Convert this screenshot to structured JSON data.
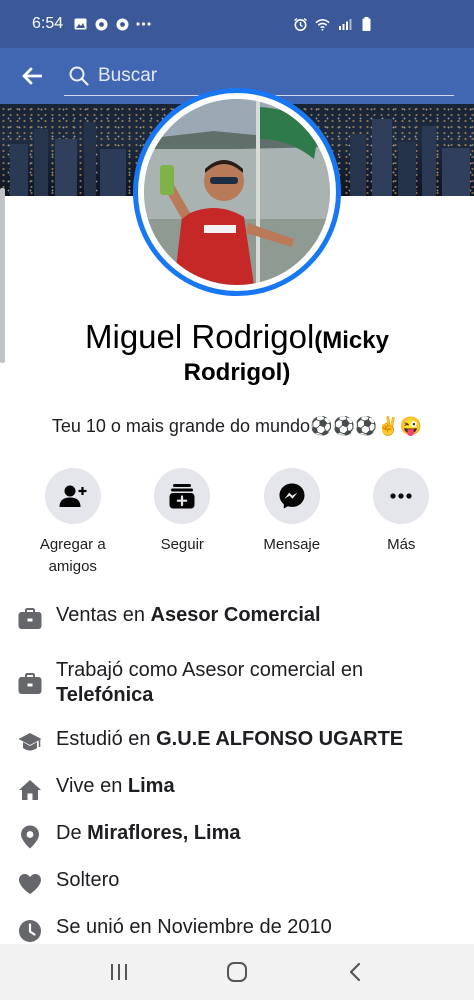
{
  "status_bar": {
    "time": "6:54",
    "left_icons": [
      "image-icon",
      "chrome-icon",
      "chrome-icon",
      "more-dots-icon"
    ],
    "right_icons": [
      "alarm-icon",
      "wifi-icon",
      "signal-icon",
      "battery-icon"
    ]
  },
  "top_bar": {
    "back_icon": "back-arrow-icon",
    "search_placeholder": "Buscar"
  },
  "profile": {
    "name": "Miguel Rodrigol",
    "alias_open": "(Micky",
    "alias_close": "Rodrigol)",
    "bio": "Teu 10 o mais grande do mundo⚽⚽⚽✌😜"
  },
  "actions": [
    {
      "label": "Agregar a amigos",
      "icon": "add-friend-icon"
    },
    {
      "label": "Seguir",
      "icon": "follow-icon"
    },
    {
      "label": "Mensaje",
      "icon": "messenger-icon"
    },
    {
      "label": "Más",
      "icon": "more-icon"
    }
  ],
  "details": [
    {
      "icon": "briefcase-icon",
      "prefix": "Ventas en ",
      "bold": "Asesor Comercial"
    },
    {
      "icon": "briefcase-icon",
      "prefix": "Trabajó como Asesor comercial en",
      "bold": "Telefónica"
    },
    {
      "icon": "graduation-cap-icon",
      "prefix": "Estudió en ",
      "bold": "G.U.E ALFONSO UGARTE"
    },
    {
      "icon": "home-icon",
      "prefix": "Vive en ",
      "bold": "Lima"
    },
    {
      "icon": "location-pin-icon",
      "prefix": "De ",
      "bold": "Miraflores, Lima"
    },
    {
      "icon": "heart-icon",
      "prefix": "Soltero",
      "bold": ""
    },
    {
      "icon": "clock-icon",
      "prefix": "Se unió en Noviembre de 2010",
      "bold": ""
    }
  ],
  "nav_bar": {
    "buttons": [
      "recent-apps-icon",
      "home-button-icon",
      "back-button-icon"
    ]
  },
  "colors": {
    "status_bar": "#3b5998",
    "top_bar": "#4267b2",
    "accent": "#1877f2",
    "action_bg": "#e4e6eb"
  }
}
